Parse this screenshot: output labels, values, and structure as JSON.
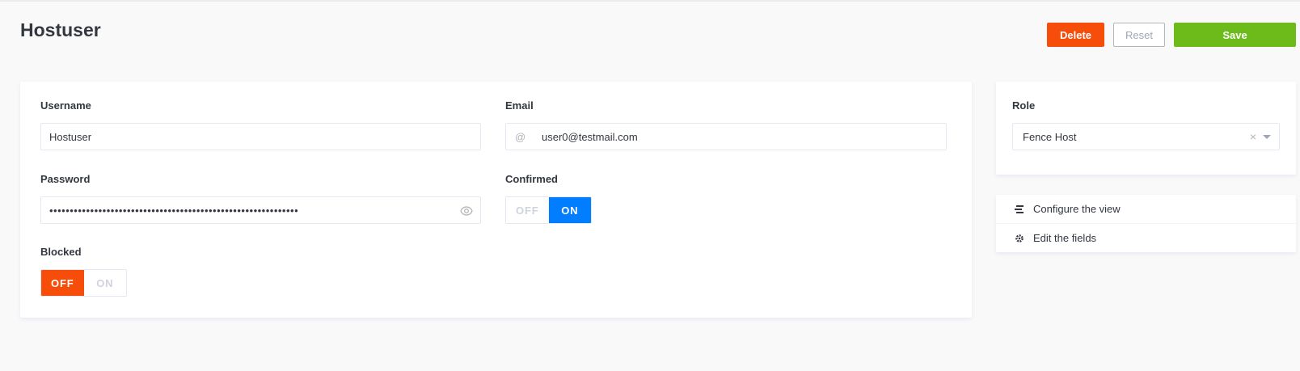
{
  "header": {
    "title": "Hostuser",
    "delete_label": "Delete",
    "reset_label": "Reset",
    "save_label": "Save"
  },
  "form": {
    "username": {
      "label": "Username",
      "value": "Hostuser"
    },
    "email": {
      "label": "Email",
      "prefix": "@",
      "value": "user0@testmail.com"
    },
    "password": {
      "label": "Password",
      "value": "•••••••••••••••••••••••••••••••••••••••••••••••••••••••••••••"
    },
    "confirmed": {
      "label": "Confirmed",
      "off_label": "OFF",
      "on_label": "ON",
      "state": "ON"
    },
    "blocked": {
      "label": "Blocked",
      "off_label": "OFF",
      "on_label": "ON",
      "state": "OFF"
    }
  },
  "role": {
    "label": "Role",
    "selected": "Fence Host",
    "clear_glyph": "×"
  },
  "links": [
    {
      "label": "Configure the view",
      "icon": "layout-icon"
    },
    {
      "label": "Edit the fields",
      "icon": "gear-icon"
    }
  ],
  "colors": {
    "delete": "#f64d0a",
    "save": "#6dbb1a",
    "toggle_on": "#007eff",
    "toggle_off": "#f64d0a"
  }
}
